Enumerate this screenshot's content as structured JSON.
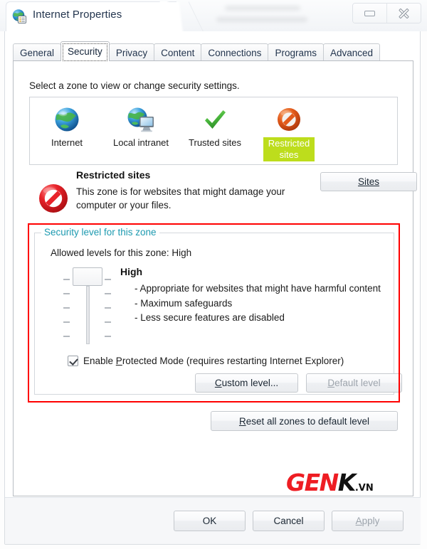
{
  "window": {
    "title": "Internet Properties",
    "icon": "internet-properties-icon",
    "controls": {
      "minimize": "minimize-icon",
      "close": "close-icon"
    }
  },
  "tabs": [
    {
      "label": "General",
      "selected": false
    },
    {
      "label": "Security",
      "selected": true
    },
    {
      "label": "Privacy",
      "selected": false
    },
    {
      "label": "Content",
      "selected": false
    },
    {
      "label": "Connections",
      "selected": false
    },
    {
      "label": "Programs",
      "selected": false
    },
    {
      "label": "Advanced",
      "selected": false
    }
  ],
  "security": {
    "intro": "Select a zone to view or change security settings.",
    "zones": [
      {
        "label": "Internet",
        "icon": "globe-icon",
        "selected": false
      },
      {
        "label": "Local intranet",
        "icon": "globe-monitor-icon",
        "selected": false
      },
      {
        "label": "Trusted sites",
        "icon": "green-checkmark-icon",
        "selected": false
      },
      {
        "label": "Restricted sites",
        "icon": "restricted-circle-icon",
        "selected": true
      }
    ],
    "selected_zone": {
      "name": "Restricted sites",
      "description": "This zone is for websites that might damage your computer or your files.",
      "icon": "restricted-red-circle-icon"
    },
    "sites_button": "Sites",
    "group": {
      "title": "Security level for this zone",
      "title_accel": "l",
      "allowed_levels": "Allowed levels for this zone: High",
      "level_name": "High",
      "level_bullets": [
        "- Appropriate for websites that might have harmful content",
        "- Maximum safeguards",
        "- Less secure features are disabled"
      ],
      "slider": {
        "position": "top",
        "tick_count": 5
      },
      "protected_mode": {
        "label_before": "Enable ",
        "label_accel": "P",
        "label_after": "rotected Mode (requires restarting Internet Explorer)",
        "checked": true
      },
      "custom_level_button": {
        "accel": "C",
        "rest": "ustom level...",
        "disabled": false
      },
      "default_level_button": {
        "accel": "D",
        "rest": "efault level",
        "disabled": true
      }
    },
    "reset_button": {
      "accel": "R",
      "rest": "eset all zones to default level"
    }
  },
  "dialog_buttons": [
    {
      "label": "OK",
      "disabled": false
    },
    {
      "label": "Cancel",
      "disabled": false
    },
    {
      "label": "Apply",
      "disabled": true,
      "accel": "A",
      "rest": "pply"
    }
  ],
  "watermark": {
    "part1": "GEN",
    "part2": "K",
    "part3": ".VN"
  },
  "colors": {
    "selection_highlight": "#bddd1c",
    "redbox_outline": "#ff0000",
    "group_title": "#1d9ab0",
    "watermark_red": "#ee1d23"
  }
}
